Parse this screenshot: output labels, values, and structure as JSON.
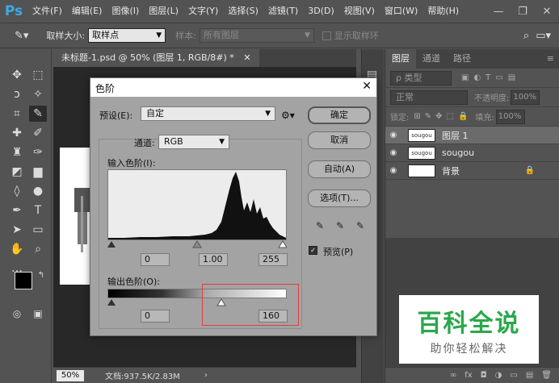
{
  "app": {
    "logo": "Ps",
    "menu": [
      "文件(F)",
      "编辑(E)",
      "图像(I)",
      "图层(L)",
      "文字(Y)",
      "选择(S)",
      "滤镜(T)",
      "3D(D)",
      "视图(V)",
      "窗口(W)",
      "帮助(H)"
    ],
    "window_controls": [
      "—",
      "❐",
      "✕"
    ]
  },
  "options_bar": {
    "sample_size_label": "取样大小:",
    "sample_size_value": "取样点",
    "sample_label": "样本:",
    "sample_value": "所有图层",
    "show_ring_label": "显示取样环"
  },
  "document": {
    "tab_title": "未标题-1.psd @ 50% (图层 1, RGB/8#) *",
    "zoom": "50%",
    "doc_info": "文档:937.5K/2.83M"
  },
  "layers_panel": {
    "tabs": [
      "图层",
      "通道",
      "路径"
    ],
    "filter_label": "ρ 类型",
    "blend_mode": "正常",
    "opacity_label": "不透明度:",
    "opacity_value": "100%",
    "lock_label": "锁定:",
    "fill_label": "填充:",
    "fill_value": "100%",
    "layers": [
      {
        "name": "图层 1",
        "thumb": "sougou",
        "selected": true
      },
      {
        "name": "sougou",
        "thumb": "sougou",
        "selected": false
      },
      {
        "name": "背景",
        "thumb": "",
        "selected": false,
        "locked": true
      }
    ],
    "footer_icons": [
      "∞",
      "fx",
      "◘",
      "◑",
      "▭",
      "▤",
      "🗑"
    ]
  },
  "levels_dialog": {
    "title": "色阶",
    "preset_label": "预设(E):",
    "preset_value": "自定",
    "channel_label": "通道:",
    "channel_value": "RGB",
    "input_levels_label": "输入色阶(I):",
    "input_black": "0",
    "input_gamma": "1.00",
    "input_white": "255",
    "output_levels_label": "输出色阶(O):",
    "output_black": "0",
    "output_white": "160",
    "buttons": {
      "ok": "确定",
      "cancel": "取消",
      "auto": "自动(A)",
      "options": "选项(T)..."
    },
    "preview_label": "预览(P)"
  },
  "watermark": {
    "title": "百科全说",
    "subtitle": "助你轻松解决"
  }
}
